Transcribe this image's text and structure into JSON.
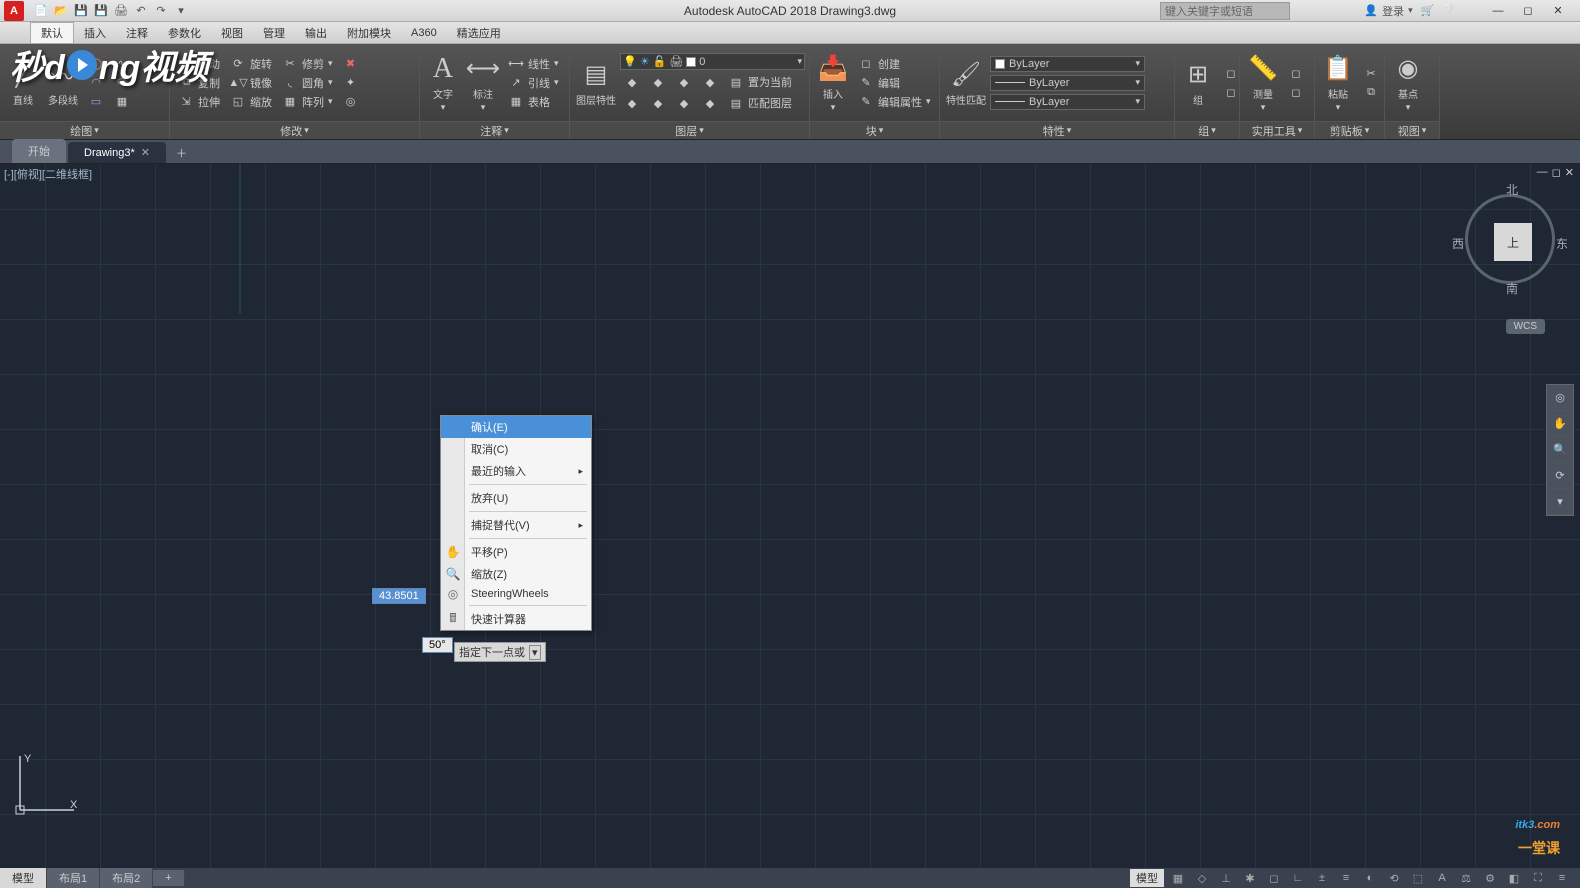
{
  "title": "Autodesk AutoCAD 2018   Drawing3.dwg",
  "search_placeholder": "键入关键字或短语",
  "login_label": "登录",
  "menu": [
    "默认",
    "插入",
    "注释",
    "参数化",
    "视图",
    "管理",
    "输出",
    "附加模块",
    "A360",
    "精选应用"
  ],
  "ribbon": {
    "draw": {
      "title": "绘图",
      "line": "直线",
      "polyline": "多段线",
      "circle": "圆",
      "arc": "圆弧"
    },
    "modify": {
      "title": "修改",
      "move": "移动",
      "rotate": "旋转",
      "trim": "修剪",
      "copy": "复制",
      "mirror": "镜像",
      "fillet": "圆角",
      "stretch": "拉伸",
      "scale": "缩放",
      "array": "阵列"
    },
    "annotate": {
      "title": "注释",
      "text": "文字",
      "dim": "标注",
      "table": "表格",
      "leader": "引线",
      "linear": "线性"
    },
    "layers": {
      "title": "图层",
      "props": "图层特性",
      "current": "0",
      "btn1": "置为当前",
      "btn2": "匹配图层"
    },
    "block": {
      "title": "块",
      "insert": "插入",
      "create": "创建",
      "edit": "编辑",
      "attr": "编辑属性"
    },
    "props": {
      "title": "特性",
      "match": "特性匹配",
      "layer": "ByLayer",
      "line1": "ByLayer",
      "line2": "ByLayer"
    },
    "group": {
      "title": "组",
      "group": "组"
    },
    "util": {
      "title": "实用工具",
      "measure": "测量"
    },
    "clip": {
      "title": "剪贴板",
      "paste": "粘贴"
    },
    "base": {
      "title": "视图",
      "base": "基点"
    }
  },
  "tabs": {
    "start": "开始",
    "active": "Drawing3*"
  },
  "viewport_label": "[-][俯视][二维线框]",
  "viewcube": {
    "top": "上",
    "n": "北",
    "s": "南",
    "e": "东",
    "w": "西",
    "wcs": "WCS"
  },
  "dynamic": {
    "dist": "43.8501",
    "angle": "50°",
    "prompt": "指定下一点或"
  },
  "context": {
    "confirm": "确认(E)",
    "cancel": "取消(C)",
    "recent": "最近的输入",
    "undo": "放弃(U)",
    "snap": "捕捉替代(V)",
    "pan": "平移(P)",
    "zoom": "缩放(Z)",
    "wheels": "SteeringWheels",
    "calc": "快速计算器"
  },
  "ucs": {
    "x": "X",
    "y": "Y"
  },
  "layout": {
    "model": "模型",
    "l1": "布局1",
    "l2": "布局2"
  },
  "status_model": "模型",
  "watermark1": "秒d  ng视频",
  "watermark2": "itk3",
  "watermark2sub": "一堂课"
}
